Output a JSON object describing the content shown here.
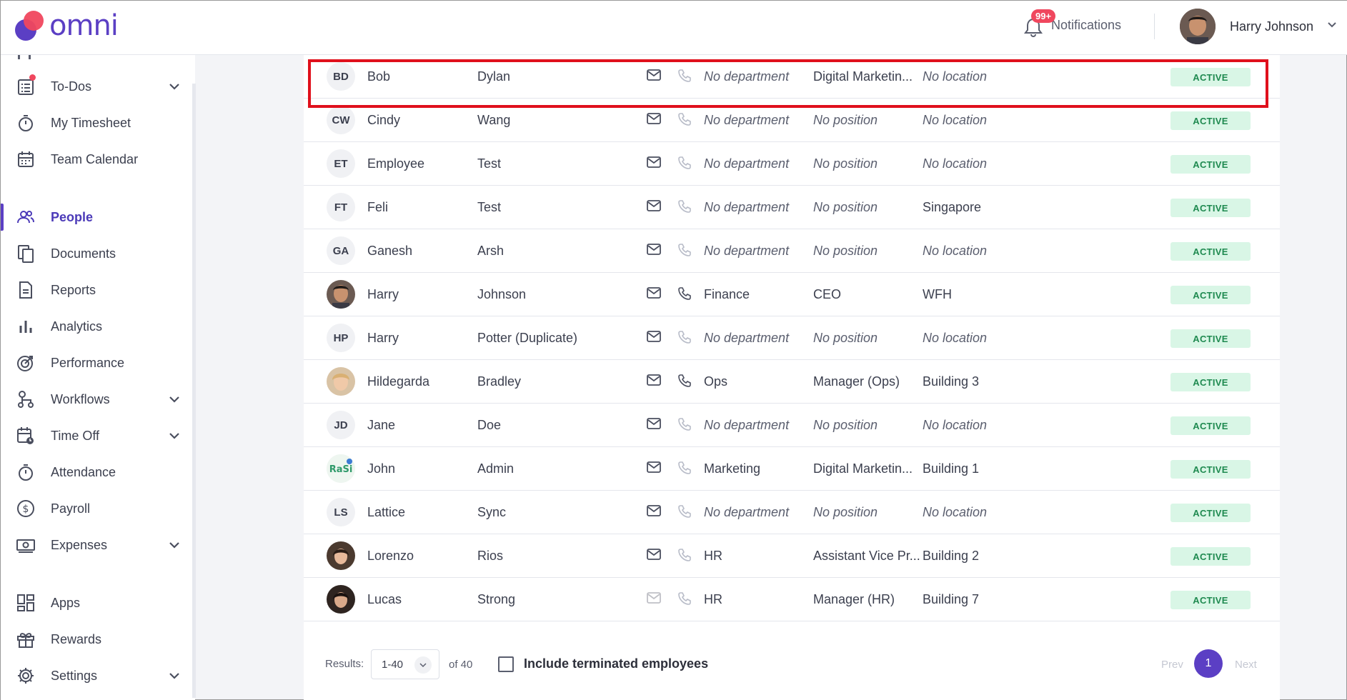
{
  "brand": {
    "name": "omni",
    "color": "#5b3fc4",
    "accent": "#f0475e"
  },
  "header": {
    "notifications_badge": "99+",
    "notifications_label": "Notifications",
    "user_name": "Harry Johnson"
  },
  "sidebar": {
    "items": [
      {
        "label": "To-Dos",
        "icon": "todo-list-icon",
        "has_chevron": true,
        "has_dot": true
      },
      {
        "label": "My Timesheet",
        "icon": "stopwatch-icon"
      },
      {
        "label": "Team Calendar",
        "icon": "calendar-icon"
      },
      {
        "label": "People",
        "icon": "people-icon",
        "active": true
      },
      {
        "label": "Documents",
        "icon": "documents-icon"
      },
      {
        "label": "Reports",
        "icon": "report-icon"
      },
      {
        "label": "Analytics",
        "icon": "bar-chart-icon"
      },
      {
        "label": "Performance",
        "icon": "target-icon"
      },
      {
        "label": "Workflows",
        "icon": "workflow-icon",
        "has_chevron": true
      },
      {
        "label": "Time Off",
        "icon": "calendar-clock-icon",
        "has_chevron": true
      },
      {
        "label": "Attendance",
        "icon": "stopwatch-icon"
      },
      {
        "label": "Payroll",
        "icon": "dollar-icon"
      },
      {
        "label": "Expenses",
        "icon": "cash-icon",
        "has_chevron": true
      },
      {
        "label": "Apps",
        "icon": "apps-grid-icon"
      },
      {
        "label": "Rewards",
        "icon": "gift-icon"
      },
      {
        "label": "Settings",
        "icon": "gear-icon",
        "has_chevron": true
      }
    ]
  },
  "table": {
    "rows": [
      {
        "initials": "BD",
        "first": "Bob",
        "last": "Dylan",
        "dept": "No department",
        "position": "Digital Marketin...",
        "location": "No location",
        "status": "ACTIVE"
      },
      {
        "initials": "CW",
        "first": "Cindy",
        "last": "Wang",
        "dept": "No department",
        "position": "No position",
        "location": "No location",
        "status": "ACTIVE"
      },
      {
        "initials": "ET",
        "first": "Employee",
        "last": "Test",
        "dept": "No department",
        "position": "No position",
        "location": "No location",
        "status": "ACTIVE"
      },
      {
        "initials": "FT",
        "first": "Feli",
        "last": "Test",
        "dept": "No department",
        "position": "No position",
        "location": "Singapore",
        "status": "ACTIVE"
      },
      {
        "initials": "GA",
        "first": "Ganesh",
        "last": "Arsh",
        "dept": "No department",
        "position": "No position",
        "location": "No location",
        "status": "ACTIVE"
      },
      {
        "initials": "",
        "photo": "male-dark",
        "first": "Harry",
        "last": "Johnson",
        "dept": "Finance",
        "position": "CEO",
        "location": "WFH",
        "status": "ACTIVE"
      },
      {
        "initials": "HP",
        "first": "Harry",
        "last": "Potter (Duplicate)",
        "dept": "No department",
        "position": "No position",
        "location": "No location",
        "status": "ACTIVE"
      },
      {
        "initials": "",
        "photo": "female-blonde",
        "first": "Hildegarda",
        "last": "Bradley",
        "dept": "Ops",
        "position": "Manager (Ops)",
        "location": "Building 3",
        "status": "ACTIVE"
      },
      {
        "initials": "JD",
        "first": "Jane",
        "last": "Doe",
        "dept": "No department",
        "position": "No position",
        "location": "No location",
        "status": "ACTIVE"
      },
      {
        "initials": "",
        "photo": "graffiti",
        "first": "John",
        "last": "Admin",
        "dept": "Marketing",
        "position": "Digital Marketin...",
        "location": "Building 1",
        "status": "ACTIVE"
      },
      {
        "initials": "LS",
        "first": "Lattice",
        "last": "Sync",
        "dept": "No department",
        "position": "No position",
        "location": "No location",
        "status": "ACTIVE"
      },
      {
        "initials": "",
        "photo": "female-brunette",
        "first": "Lorenzo",
        "last": "Rios",
        "dept": "HR",
        "position": "Assistant Vice Pr...",
        "location": "Building 2",
        "status": "ACTIVE"
      },
      {
        "initials": "",
        "photo": "female-dark",
        "first": "Lucas",
        "last": "Strong",
        "dept": "HR",
        "position": "Manager (HR)",
        "location": "Building 7",
        "status": "ACTIVE"
      }
    ]
  },
  "footer": {
    "results_label": "Results:",
    "page_size": "1-40",
    "of_total": "of 40",
    "include_terminated_label": "Include terminated employees",
    "prev_label": "Prev",
    "current_page": "1",
    "next_label": "Next"
  }
}
